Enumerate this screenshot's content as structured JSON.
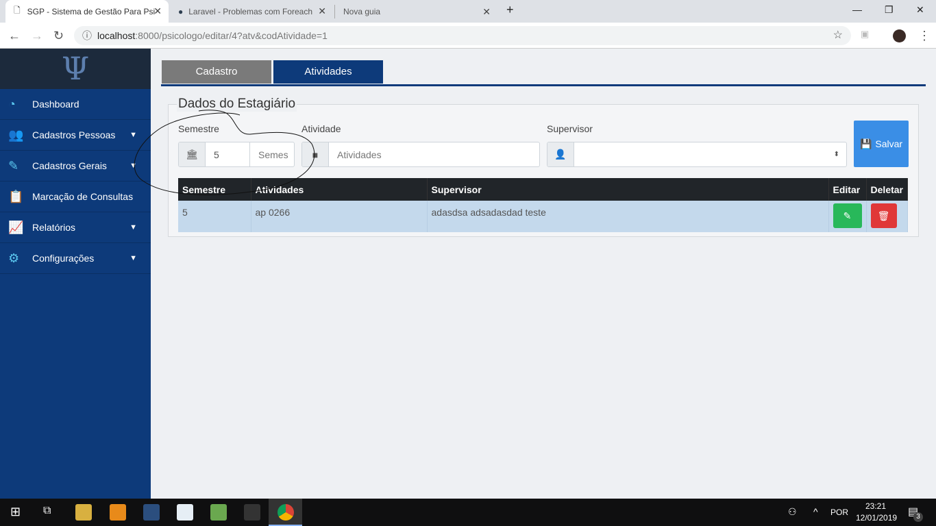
{
  "browser": {
    "tabs": [
      {
        "title": "SGP - Sistema de Gestão Para Psi"
      },
      {
        "title": "Laravel - Problemas com Foreach"
      },
      {
        "title": "Nova guia"
      }
    ],
    "url_host": "localhost",
    "url_path": ":8000/psicologo/editar/4?atv&codAtividade=1"
  },
  "sidebar": {
    "logo": "Ψ",
    "items": [
      {
        "label": "Dashboard",
        "icon": "dashboard-icon"
      },
      {
        "label": "Cadastros Pessoas",
        "icon": "users-icon"
      },
      {
        "label": "Cadastros Gerais",
        "icon": "pencil-icon"
      },
      {
        "label": "Marcação de Consultas",
        "icon": "clipboard-icon"
      },
      {
        "label": "Relatórios",
        "icon": "chart-icon"
      },
      {
        "label": "Configurações",
        "icon": "gear-icon"
      }
    ]
  },
  "page_tabs": [
    "Cadastro",
    "Atividades"
  ],
  "panel": {
    "title": "Dados do Estagiário",
    "semestre_label": "Semestre",
    "semestre_value": "5",
    "semestre_suffix": "Semes",
    "atividade_label": "Atividade",
    "atividade_placeholder": "Atividades",
    "supervisor_label": "Supervisor",
    "save_label": "Salvar"
  },
  "table": {
    "headers": [
      "Semestre",
      "Atividades",
      "Supervisor",
      "Editar",
      "Deletar"
    ],
    "rows": [
      {
        "semestre": "5",
        "atividade": "ap 0266",
        "supervisor": "adasdsa adsadasdad teste"
      }
    ]
  },
  "taskbar": {
    "lang": "POR",
    "time": "23:21",
    "date": "12/01/2019",
    "notifications": "3"
  },
  "colors": {
    "sidebar": "#0d3a7a",
    "accent": "#3a8ee6",
    "edit": "#28b85a",
    "delete": "#e03838"
  }
}
